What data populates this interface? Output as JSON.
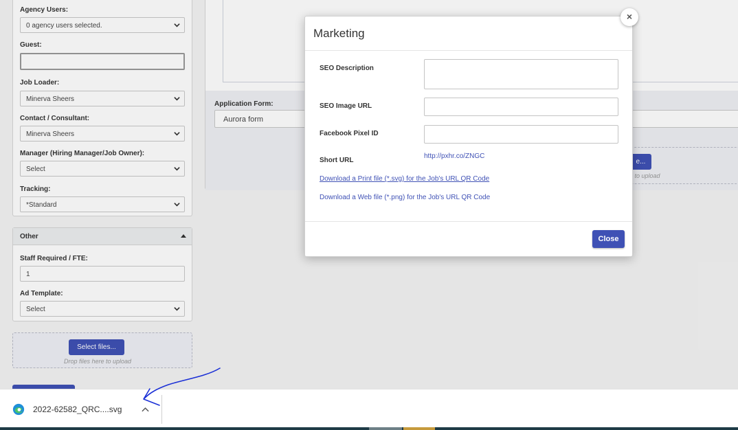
{
  "left_form": {
    "agency_users": {
      "label": "Agency Users:",
      "value": "0 agency users selected."
    },
    "guest": {
      "label": "Guest:",
      "value": ""
    },
    "job_loader": {
      "label": "Job Loader:",
      "value": "Minerva Sheers"
    },
    "contact": {
      "label": "Contact / Consultant:",
      "value": "Minerva Sheers"
    },
    "manager": {
      "label": "Manager (Hiring Manager/Job Owner):",
      "value": "Select"
    },
    "tracking": {
      "label": "Tracking:",
      "value": "*Standard"
    }
  },
  "other_panel": {
    "title": "Other",
    "staff": {
      "label": "Staff Required / FTE:",
      "value": "1"
    },
    "ad_template": {
      "label": "Ad Template:",
      "value": "Select"
    }
  },
  "upload_left": {
    "button": "Select files...",
    "hint": "Drop files here to upload"
  },
  "right_panel": {
    "application_form": {
      "label": "Application Form:",
      "value": "Aurora form"
    },
    "upload_button_fragment": "e...",
    "upload_hint_fragment": "e to upload"
  },
  "modal": {
    "title": "Marketing",
    "close_x": "×",
    "seo_description": {
      "label": "SEO Description",
      "value": ""
    },
    "seo_image_url": {
      "label": "SEO Image URL",
      "value": ""
    },
    "facebook_pixel": {
      "label": "Facebook Pixel ID",
      "value": ""
    },
    "short_url": {
      "label": "Short URL",
      "value": "http://pxhr.co/ZNGC"
    },
    "download_print": "Download a Print file (*.svg) for the Job's URL QR Code",
    "download_web": "Download a Web file (*.png) for the Job's URL QR Code",
    "close_button": "Close"
  },
  "download_bar": {
    "file_name": "2022-62582_QRC....svg",
    "browser_icon": "edge-icon"
  },
  "colors": {
    "accent": "#3f51b5",
    "annotation": "#1a2fd6"
  }
}
